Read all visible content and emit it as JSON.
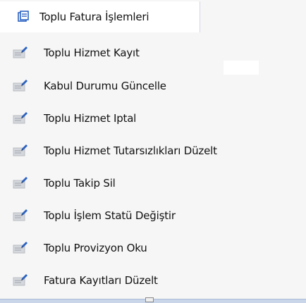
{
  "menu": {
    "header": {
      "label": "Toplu Fatura İşlemleri",
      "icon": "document-stack-icon"
    },
    "items": [
      {
        "label": "Toplu Hizmet Kayıt",
        "icon": "document-edit-icon"
      },
      {
        "label": "Kabul Durumu Güncelle",
        "icon": "document-edit-icon"
      },
      {
        "label": "Toplu Hizmet Iptal",
        "icon": "document-edit-icon"
      },
      {
        "label": "Toplu Hizmet Tutarsızlıkları Düzelt",
        "icon": "document-edit-icon"
      },
      {
        "label": "Toplu Takip Sil",
        "icon": "document-edit-icon"
      },
      {
        "label": "Toplu İşlem Statü Değiştir",
        "icon": "document-edit-icon"
      },
      {
        "label": "Toplu Provizyon Oku",
        "icon": "document-edit-icon"
      },
      {
        "label": "Fatura Kayıtları Düzelt",
        "icon": "document-edit-icon"
      }
    ]
  },
  "colors": {
    "icon_blue": "#2b62c2",
    "icon_gray": "#b9bcc2",
    "selected_bg": "#ffffff",
    "menu_bg": "#f6f6f6"
  }
}
